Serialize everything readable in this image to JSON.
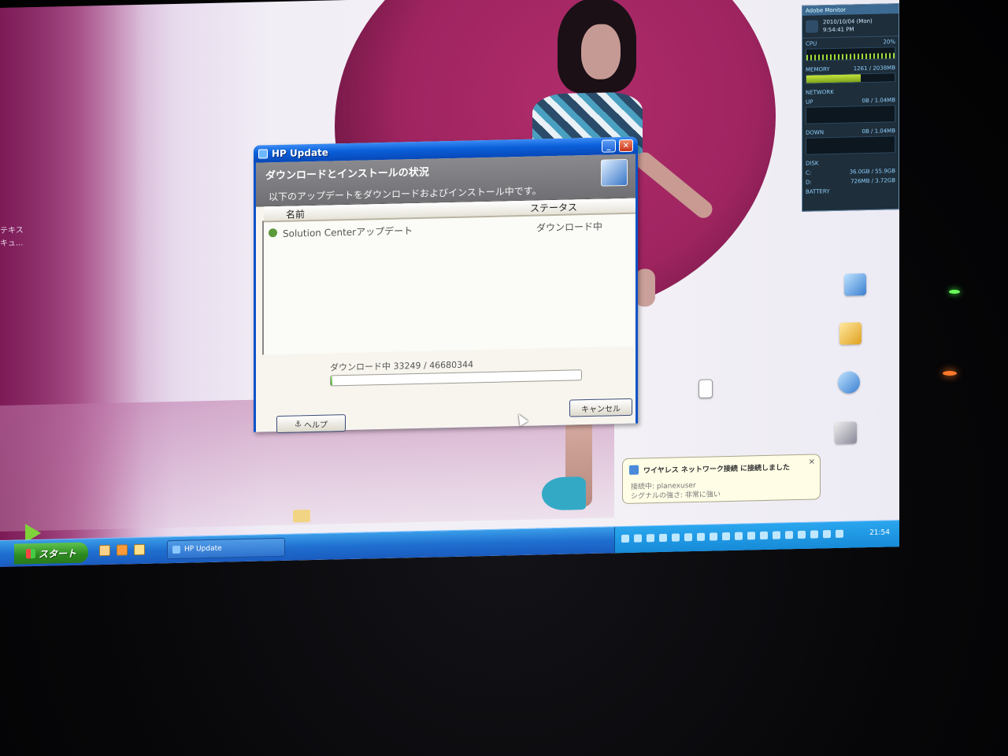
{
  "window": {
    "title": "HP Update",
    "banner_title": "ダウンロードとインストールの状況",
    "banner_subtitle": "以下のアップデートをダウンロードおよびインストール中です。",
    "columns": {
      "name": "名前",
      "status": "ステータス"
    },
    "rows": [
      {
        "name": "Solution Centerアップデート",
        "status": "ダウンロード中"
      }
    ],
    "progress_text": "ダウンロード中 33249 / 46680344",
    "progress_fraction": 0.0007,
    "help_button": "ヘルプ",
    "cancel_button": "キャンセル"
  },
  "gadget": {
    "title": "Adobe Monitor",
    "date": "2010/10/04 (Mon)",
    "time": "9:54:41 PM",
    "cpu_label": "CPU",
    "cpu_value": "20%",
    "memory_label": "MEMORY",
    "memory_value": "1261 / 2038MB",
    "network_label": "NETWORK",
    "up_label": "UP",
    "up_value": "0B / 1.04MB",
    "down_label": "DOWN",
    "down_value": "0B / 1.04MB",
    "disk_label": "DISK",
    "disk_c": "C:",
    "disk_c_value": "36.0GB / 55.9GB",
    "disk_d": "D:",
    "disk_d_value": "726MB / 3.72GB",
    "battery_label": "BATTERY"
  },
  "balloon": {
    "title": "ワイヤレス ネットワーク接続 に接続しました",
    "line1": "接続中: planexuser",
    "line2": "シグナルの強さ: 非常に強い"
  },
  "taskbar": {
    "start_label": "スタート",
    "task_label": "HP Update",
    "clock": "21:54"
  },
  "desktop": {
    "left_label_1": "テキス",
    "left_label_2": "キュ..."
  }
}
